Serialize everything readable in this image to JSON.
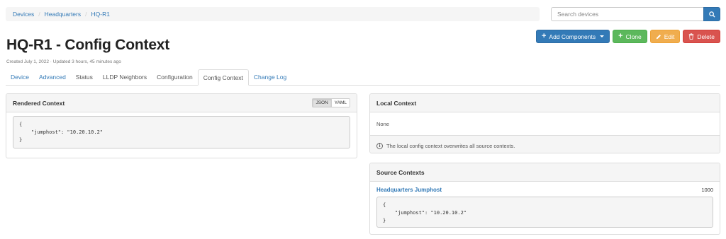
{
  "breadcrumb": [
    "Devices",
    "Headquarters",
    "HQ-R1"
  ],
  "search": {
    "placeholder": "Search devices"
  },
  "actions": {
    "add_components": "Add Components",
    "clone": "Clone",
    "edit": "Edit",
    "delete": "Delete"
  },
  "title": "HQ-R1 - Config Context",
  "subtitle": "Created July 1, 2022 · Updated 3 hours, 45 minutes ago",
  "tabs": [
    "Device",
    "Advanced",
    "Status",
    "LLDP Neighbors",
    "Configuration",
    "Config Context",
    "Change Log"
  ],
  "rendered": {
    "heading": "Rendered Context",
    "format_options": [
      "JSON",
      "YAML"
    ],
    "code": "{\n    \"jumphost\": \"10.20.10.2\"\n}"
  },
  "local": {
    "heading": "Local Context",
    "value": "None",
    "note": "The local config context overwrites all source contexts."
  },
  "sources": {
    "heading": "Source Contexts",
    "items": [
      {
        "name": "Headquarters Jumphost",
        "weight": "1000",
        "code": "{\n    \"jumphost\": \"10.20.10.2\"\n}"
      }
    ]
  },
  "colors": {
    "primary": "#337ab7",
    "success": "#5cb85c",
    "warning": "#f0ad4e",
    "danger": "#d9534f"
  }
}
